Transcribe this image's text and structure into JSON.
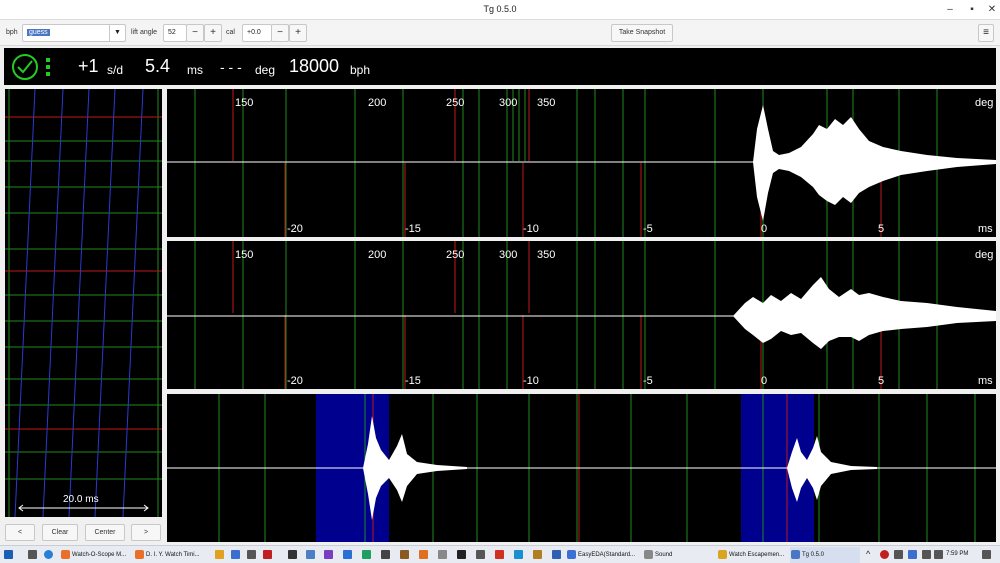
{
  "window": {
    "title": "Tg 0.5.0",
    "minimize": "–",
    "maximize": "▪",
    "close": "✕"
  },
  "toolbar": {
    "bph_label": "bph",
    "bph_value": "guess",
    "lift_label": "lift angle",
    "lift_value": "52",
    "minus": "−",
    "plus": "+",
    "cal_label": "cal",
    "cal_value": "+0.0",
    "snapshot_label": "Take Snapshot",
    "menu_icon": "≡"
  },
  "status": {
    "rate": "+1",
    "rate_unit": "s/d",
    "beat_error": "5.4",
    "beat_error_unit": "ms",
    "amplitude": "- - -",
    "amplitude_unit": "deg",
    "bph": "18000",
    "bph_unit": "bph"
  },
  "trace_panel": {
    "scale_label": "20.0 ms"
  },
  "controls": {
    "prev": "<",
    "clear": "Clear",
    "center": "Center",
    "next": ">"
  },
  "tic_panels": {
    "deg_ticks": [
      "150",
      "200",
      "250",
      "300",
      "350"
    ],
    "deg_unit": "deg",
    "ms_ticks": [
      "-20",
      "-15",
      "-10",
      "-5",
      "0",
      "5"
    ],
    "ms_unit": "ms"
  },
  "taskbar": {
    "apps": [
      {
        "label": "Watch-O-Scope M...",
        "color": "#e8702a"
      },
      {
        "label": "D. I. Y. Watch Timi...",
        "color": "#e8702a"
      },
      {
        "label": "EasyEDA(Standard...",
        "color": "#3b6fd4"
      },
      {
        "label": "Sound",
        "color": "#888888"
      },
      {
        "label": "Watch Escapemen...",
        "color": "#d9a520"
      },
      {
        "label": "Tg 0.5.0",
        "color": "#4a77c4"
      }
    ],
    "time": "7:59 PM"
  }
}
